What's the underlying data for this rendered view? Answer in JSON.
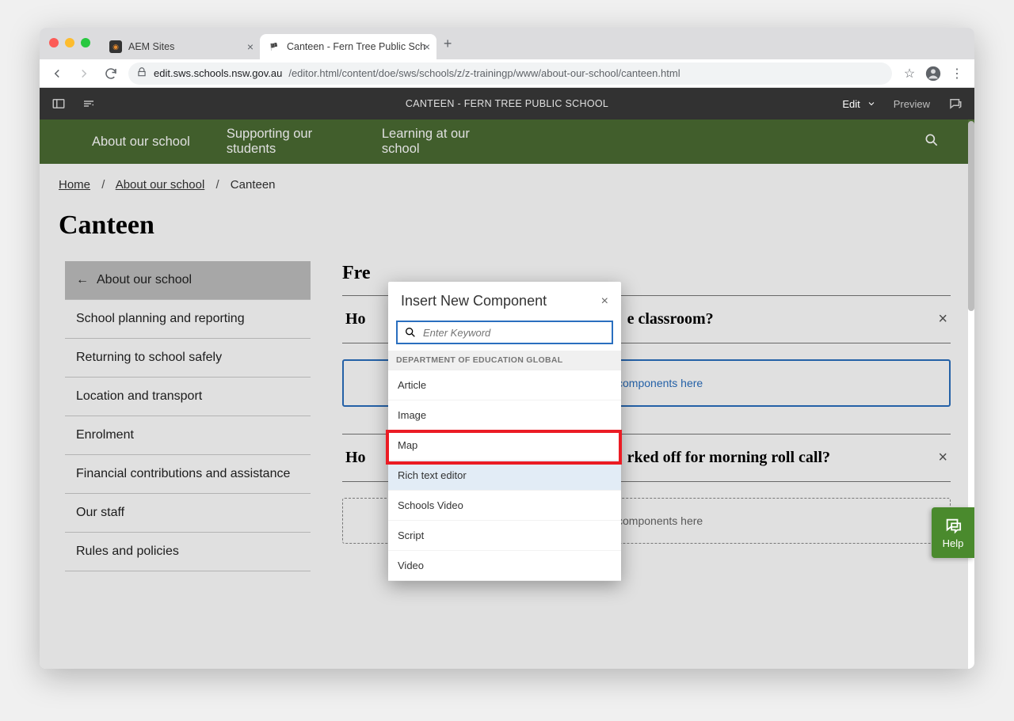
{
  "browser": {
    "tabs": [
      {
        "title": "AEM Sites",
        "active": false
      },
      {
        "title": "Canteen - Fern Tree Public Sch",
        "active": true
      }
    ],
    "address_host": "edit.sws.schools.nsw.gov.au",
    "address_path": "/editor.html/content/doe/sws/schools/z/z-trainingp/www/about-our-school/canteen.html"
  },
  "aem": {
    "title": "CANTEEN - FERN TREE PUBLIC SCHOOL",
    "mode_label": "Edit",
    "preview_label": "Preview"
  },
  "nav": {
    "items": [
      "About our school",
      "Supporting our students",
      "Learning at our school"
    ]
  },
  "breadcrumbs": {
    "home": "Home",
    "section": "About our school",
    "page": "Canteen"
  },
  "page_title": "Canteen",
  "side_nav": {
    "current": "About our school",
    "items": [
      "School planning and reporting",
      "Returning to school safely",
      "Location and transport",
      "Enrolment",
      "Financial contributions and assistance",
      "Our staff",
      "Rules and policies"
    ]
  },
  "main": {
    "faq_heading_fragment": "Fre",
    "accordion1_fragment_left": "Ho",
    "accordion1_fragment_right": "e classroom?",
    "accordion2_fragment_left": "Ho",
    "accordion2_fragment_right": "rked off for morning roll call?",
    "dropzone_fragment": "components here",
    "dropzone_full": "Drag components here"
  },
  "modal": {
    "title": "Insert New Component",
    "search_placeholder": "Enter Keyword",
    "group_label": "DEPARTMENT OF EDUCATION GLOBAL",
    "components": [
      "Article",
      "Image",
      "Map",
      "Rich text editor",
      "Schools Video",
      "Script",
      "Video"
    ],
    "highlight_index": 3
  },
  "help_label": "Help"
}
